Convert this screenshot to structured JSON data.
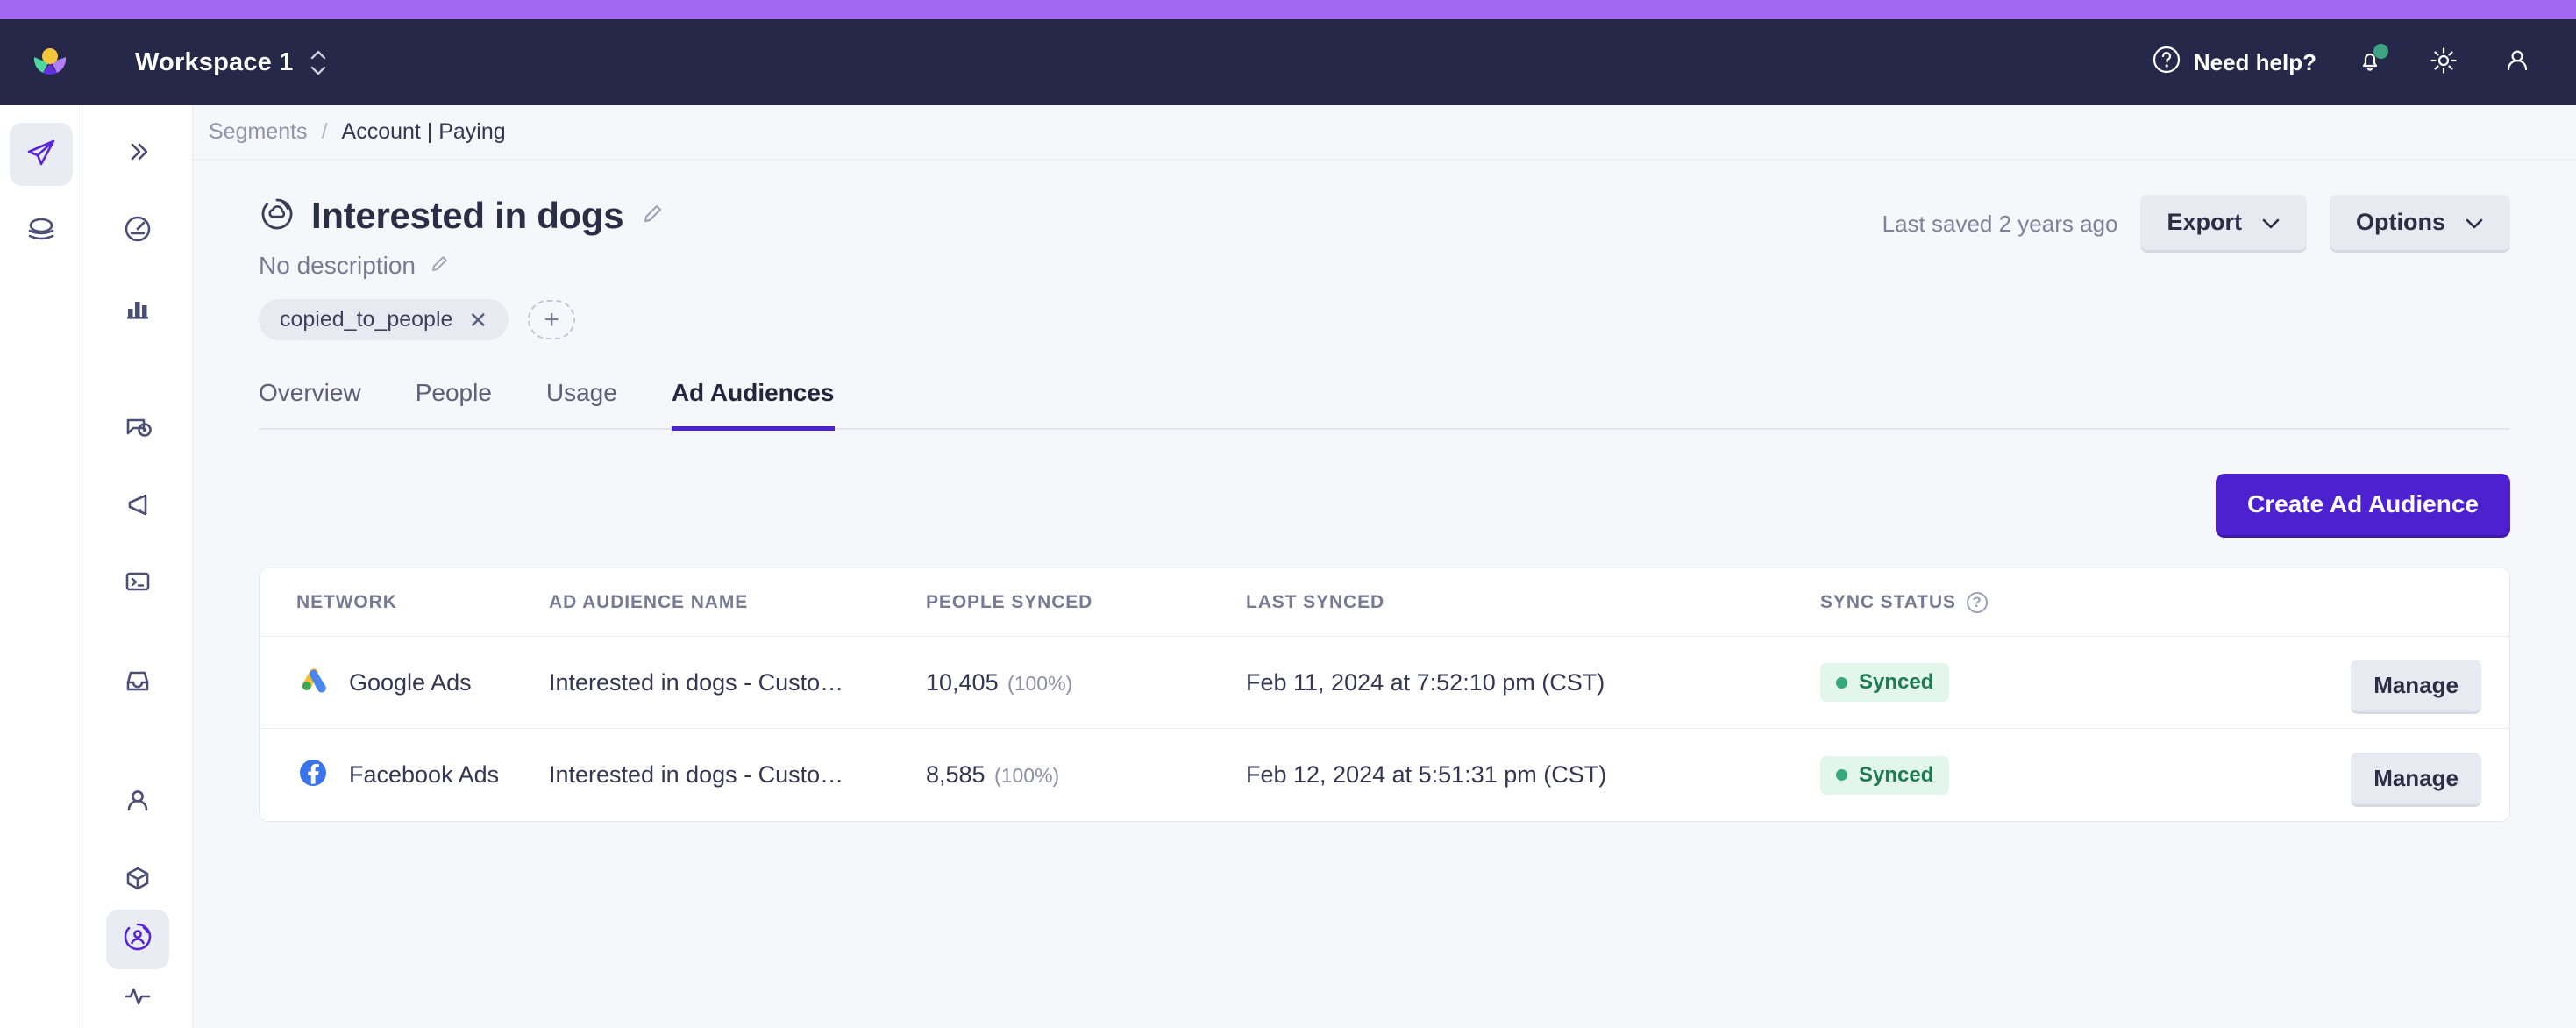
{
  "topbar": {
    "workspace_name": "Workspace 1",
    "need_help_label": "Need help?",
    "logo_icon": "customerio-logo",
    "workspace_switcher_icon": "chevron-updown-icon",
    "help_icon": "question-circle-icon",
    "notifications_icon": "bell-icon",
    "settings_icon": "gear-icon",
    "account_icon": "user-icon",
    "notification_badge_color": "#3fa381",
    "accent_strip_color": "#a368f0",
    "bar_color": "#252848"
  },
  "rail_primary": {
    "items": [
      {
        "icon": "paper-plane-icon",
        "active": true
      },
      {
        "icon": "layers-icon",
        "active": false
      }
    ]
  },
  "rail_secondary": {
    "items": [
      {
        "icon": "chevrons-right-icon",
        "active": false
      },
      {
        "icon": "dashboard-gauge-icon",
        "active": false
      },
      {
        "icon": "bar-chart-icon",
        "active": false
      },
      {
        "icon": "message-target-icon",
        "active": false
      },
      {
        "icon": "megaphone-icon",
        "active": false
      },
      {
        "icon": "terminal-icon",
        "active": false
      },
      {
        "icon": "inbox-icon",
        "active": false
      },
      {
        "icon": "person-icon",
        "active": false
      },
      {
        "icon": "cube-icon",
        "active": false
      },
      {
        "icon": "segment-person-icon",
        "active": true
      },
      {
        "icon": "activity-pulse-icon",
        "active": false
      }
    ]
  },
  "breadcrumb": {
    "root": "Segments",
    "separator": "/",
    "current": "Account | Paying"
  },
  "header": {
    "segment_icon": "segment-cloud-icon",
    "title": "Interested in dogs",
    "title_edit_icon": "pencil-icon",
    "description": "No description",
    "description_edit_icon": "pencil-icon",
    "tags": [
      {
        "label": "copied_to_people",
        "remove_icon": "close-icon"
      }
    ],
    "add_tag_icon": "plus-icon",
    "last_saved": "Last saved 2 years ago",
    "export_label": "Export",
    "options_label": "Options",
    "dropdown_icon": "chevron-down-icon"
  },
  "tabs": [
    {
      "label": "Overview",
      "active": false
    },
    {
      "label": "People",
      "active": false
    },
    {
      "label": "Usage",
      "active": false
    },
    {
      "label": "Ad Audiences",
      "active": true
    }
  ],
  "actions": {
    "create_ad_audience": "Create Ad Audience",
    "primary_color": "#4d21d0"
  },
  "table": {
    "columns": [
      {
        "label": "NETWORK"
      },
      {
        "label": "AD AUDIENCE NAME"
      },
      {
        "label": "PEOPLE SYNCED"
      },
      {
        "label": "LAST SYNCED"
      },
      {
        "label": "SYNC STATUS",
        "help_icon": "question-circle-icon"
      }
    ],
    "rows": [
      {
        "network": "Google Ads",
        "network_icon": "google-ads-icon",
        "audience_name": "Interested in dogs - Custo…",
        "people_synced": "10,405",
        "people_synced_pct": "(100%)",
        "last_synced": "Feb 11, 2024 at 7:52:10 pm (CST)",
        "status": "Synced",
        "status_color": "#35a97a",
        "action_label": "Manage"
      },
      {
        "network": "Facebook Ads",
        "network_icon": "facebook-ads-icon",
        "audience_name": "Interested in dogs - Custo…",
        "people_synced": "8,585",
        "people_synced_pct": "(100%)",
        "last_synced": "Feb 12, 2024 at 5:51:31 pm (CST)",
        "status": "Synced",
        "status_color": "#35a97a",
        "action_label": "Manage"
      }
    ]
  }
}
